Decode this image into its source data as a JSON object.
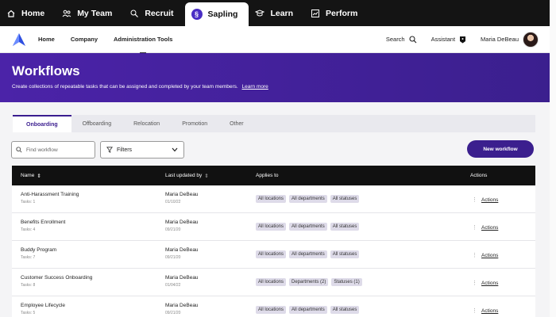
{
  "product_tabs": [
    {
      "label": "Home",
      "icon": "home-icon"
    },
    {
      "label": "My Team",
      "icon": "team-icon"
    },
    {
      "label": "Recruit",
      "icon": "recruit-icon"
    },
    {
      "label": "Sapling",
      "icon": "sapling-icon"
    },
    {
      "label": "Learn",
      "icon": "learn-icon"
    },
    {
      "label": "Perform",
      "icon": "perform-icon"
    }
  ],
  "active_product": "Sapling",
  "nav": {
    "links": [
      "Home",
      "Company",
      "Administration Tools"
    ],
    "active": "Administration Tools",
    "search_label": "Search",
    "assistant_label": "Assistant",
    "user_name": "Maria DeBeau"
  },
  "hero": {
    "title": "Workflows",
    "description": "Create collections of repeatable tasks that can be assigned and completed by your team members.",
    "learn_more": "Learn more",
    "gradient_colors": [
      "#4b23a8",
      "#3b1f8e"
    ]
  },
  "tabs": [
    "Onboarding",
    "Offboarding",
    "Relocation",
    "Promotion",
    "Other"
  ],
  "active_tab": "Onboarding",
  "toolbar": {
    "search_placeholder": "Find workflow",
    "filters_label": "Filters",
    "new_button": "New workflow"
  },
  "table": {
    "columns": {
      "name": "Name",
      "updated": "Last updated by",
      "applies": "Applies to",
      "actions": "Actions"
    },
    "rows": [
      {
        "name": "Anti-Harassment Training",
        "tasks": "Tasks: 1",
        "updated_by": "Maria DeBeau",
        "date": "01/10/22",
        "chips": [
          "All locations",
          "All departments",
          "All statuses"
        ],
        "action": "Actions"
      },
      {
        "name": "Benefits Enrollment",
        "tasks": "Tasks: 4",
        "updated_by": "Maria DeBeau",
        "date": "09/21/20",
        "chips": [
          "All locations",
          "All departments",
          "All statuses"
        ],
        "action": "Actions"
      },
      {
        "name": "Buddy Program",
        "tasks": "Tasks: 7",
        "updated_by": "Maria DeBeau",
        "date": "09/21/20",
        "chips": [
          "All locations",
          "All departments",
          "All statuses"
        ],
        "action": "Actions"
      },
      {
        "name": "Customer Success Onboarding",
        "tasks": "Tasks: 8",
        "updated_by": "Maria DeBeau",
        "date": "01/04/22",
        "chips": [
          "All locations",
          "Departments (2)",
          "Statuses (1)"
        ],
        "action": "Actions"
      },
      {
        "name": "Employee Lifecycle",
        "tasks": "Tasks: 5",
        "updated_by": "Maria DeBeau",
        "date": "09/21/20",
        "chips": [
          "All locations",
          "All departments",
          "All statuses"
        ],
        "action": "Actions"
      }
    ]
  },
  "colors": {
    "accent": "#3b1f8e",
    "topbar": "#141414",
    "chip": "#dedbe9"
  }
}
